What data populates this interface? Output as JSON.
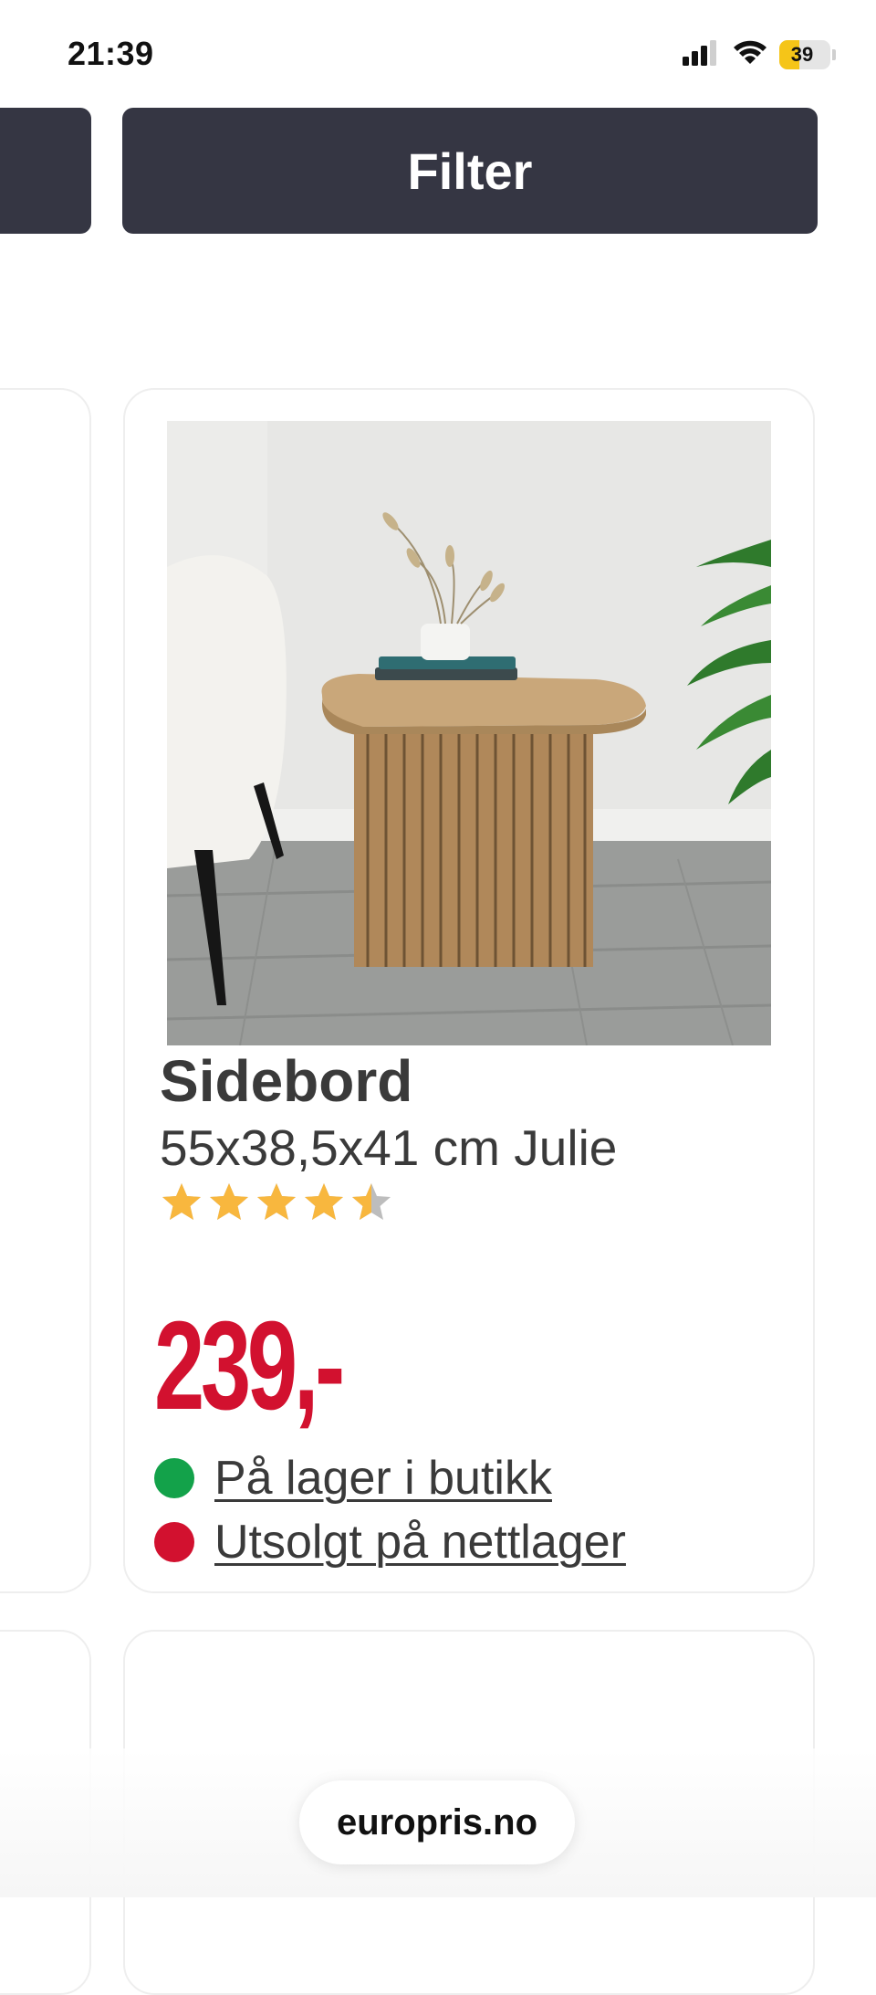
{
  "status_bar": {
    "time": "21:39",
    "battery_level": "39",
    "battery_fraction": 0.39
  },
  "header": {
    "filter_label": "Filter"
  },
  "product": {
    "title": "Sidebord",
    "subtitle": "55x38,5x41 cm Julie",
    "rating": 4.5,
    "rating_max": 5,
    "price": "239,-",
    "availability": [
      {
        "label": "På lager i butikk",
        "status_color": "#13a24a"
      },
      {
        "label": "Utsolgt på nettlager",
        "status_color": "#d2112f"
      }
    ]
  },
  "browser": {
    "url": "europris.no"
  },
  "colors": {
    "button_bg": "#353643",
    "price": "#d2112f",
    "star_fill": "#f8b73e",
    "star_empty": "#bdbdbd"
  }
}
